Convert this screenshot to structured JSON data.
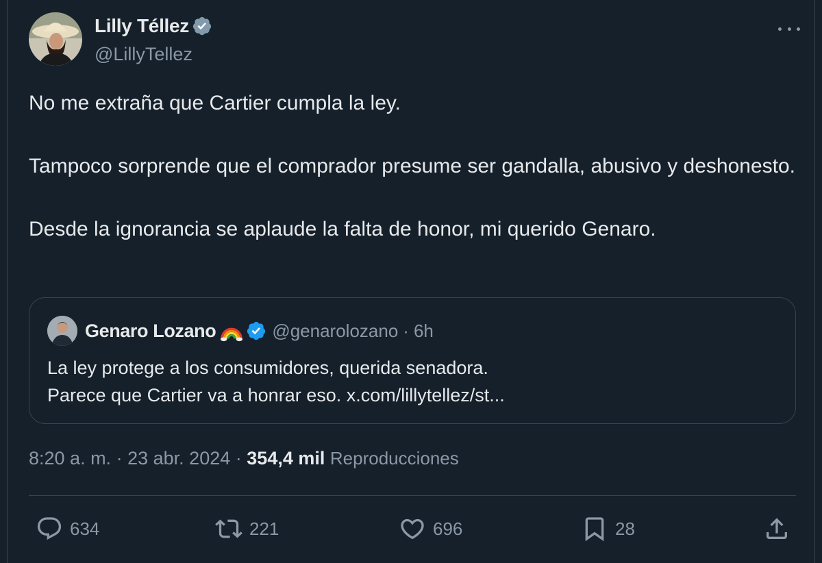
{
  "author": {
    "name": "Lilly Téllez",
    "handle": "@LillyTellez",
    "verified_color": "#829aab"
  },
  "tweet": {
    "paragraphs": [
      "No me extraña que Cartier cumpla la ley.",
      "Tampoco sorprende que el comprador presume ser gandalla, abusivo y deshonesto.",
      "Desde la ignorancia se aplaude la falta de honor, mi querido Genaro."
    ]
  },
  "quoted": {
    "name": "Genaro Lozano",
    "emoji_icon": "rainbow-icon",
    "verified_color": "#1d9bf0",
    "handle": "@genarolozano",
    "separator": "·",
    "time": "6h",
    "lines": [
      "La ley protege a los consumidores, querida senadora.",
      "Parece que Cartier va a honrar eso. x.com/lillytellez/st..."
    ]
  },
  "meta": {
    "time": "8:20 a. m.",
    "sep1": "·",
    "date": "23 abr. 2024",
    "sep2": "·",
    "views_count": "354,4 mil",
    "views_label": "Reproducciones"
  },
  "actions": {
    "replies": "634",
    "reposts": "221",
    "likes": "696",
    "bookmarks": "28"
  },
  "colors": {
    "background": "#15202b",
    "text": "#e7e9ea",
    "secondary": "#8b98a5",
    "border": "#38444d"
  }
}
